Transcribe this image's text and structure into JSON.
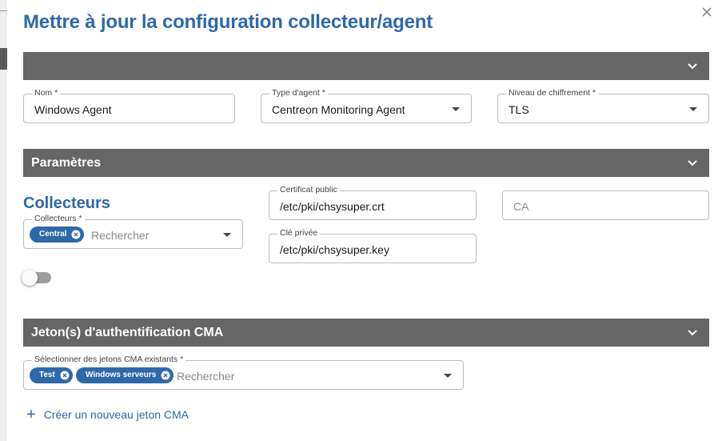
{
  "dialog": {
    "title": "Mettre à jour la configuration collecteur/agent",
    "close_icon": "close-icon"
  },
  "sections": {
    "general_label": "",
    "parameters_label": "Paramètres",
    "cma_tokens_label": "Jeton(s) d'authentification CMA"
  },
  "fields": {
    "name": {
      "label": "Nom *",
      "value": "Windows Agent"
    },
    "agent_type": {
      "label": "Type d'agent *",
      "value": "Centreon Monitoring Agent"
    },
    "encryption": {
      "label": "Niveau de chiffrement *",
      "value": "TLS"
    },
    "public_cert": {
      "label": "Certificat public",
      "value": "/etc/pki/chsysuper.crt"
    },
    "private_key": {
      "label": "Clé privée",
      "value": "/etc/pki/chsysuper.key"
    },
    "ca": {
      "placeholder": "CA"
    }
  },
  "collectors": {
    "heading": "Collecteurs",
    "field_label": "Collecteurs *",
    "chips": [
      "Central"
    ],
    "search_placeholder": "Rechercher"
  },
  "toggle": {
    "state": "off"
  },
  "tokens": {
    "field_label": "Sélectionner des jetons CMA existants *",
    "chips": [
      "Test",
      "Windows serveurs"
    ],
    "search_placeholder": "Rechercher",
    "add_label": "Créer un nouveau jeton CMA"
  },
  "colors": {
    "accent": "#2e68aa",
    "section_bar": "#666666"
  }
}
